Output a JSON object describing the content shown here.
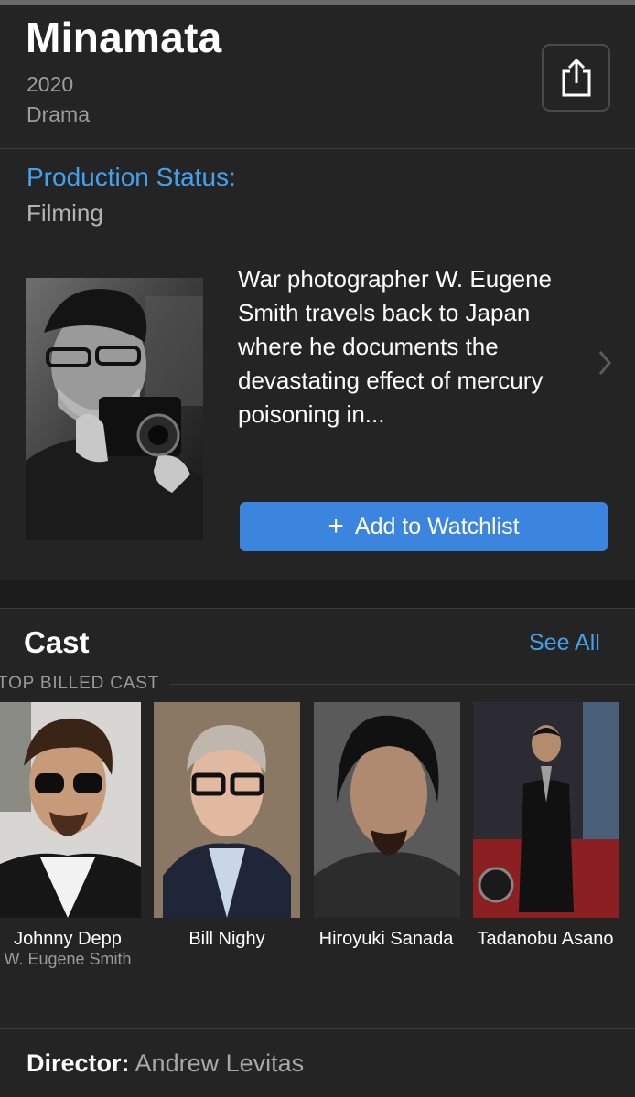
{
  "movie": {
    "title": "Minamata",
    "year": "2020",
    "genre": "Drama"
  },
  "production": {
    "label": "Production Status:",
    "value": "Filming"
  },
  "synopsis": {
    "text": "War photographer W. Eugene Smith travels back to Japan where he documents the devastating effect of mercury poisoning in..."
  },
  "actions": {
    "watchlist_plus": "+",
    "watchlist_label": "Add to Watchlist",
    "share_icon": "share-icon"
  },
  "cast": {
    "heading": "Cast",
    "see_all": "See All",
    "section_label": "TOP BILLED CAST",
    "members": [
      {
        "name": "Johnny Depp",
        "role": "W. Eugene Smith"
      },
      {
        "name": "Bill Nighy",
        "role": ""
      },
      {
        "name": "Hiroyuki Sanada",
        "role": ""
      },
      {
        "name": "Tadanobu Asano",
        "role": ""
      }
    ]
  },
  "director": {
    "label": "Director:",
    "name": "Andrew Levitas"
  },
  "colors": {
    "background": "#242424",
    "accent": "#43a2ee",
    "button": "#3b85de",
    "secondary_text": "#9d9d9d"
  }
}
